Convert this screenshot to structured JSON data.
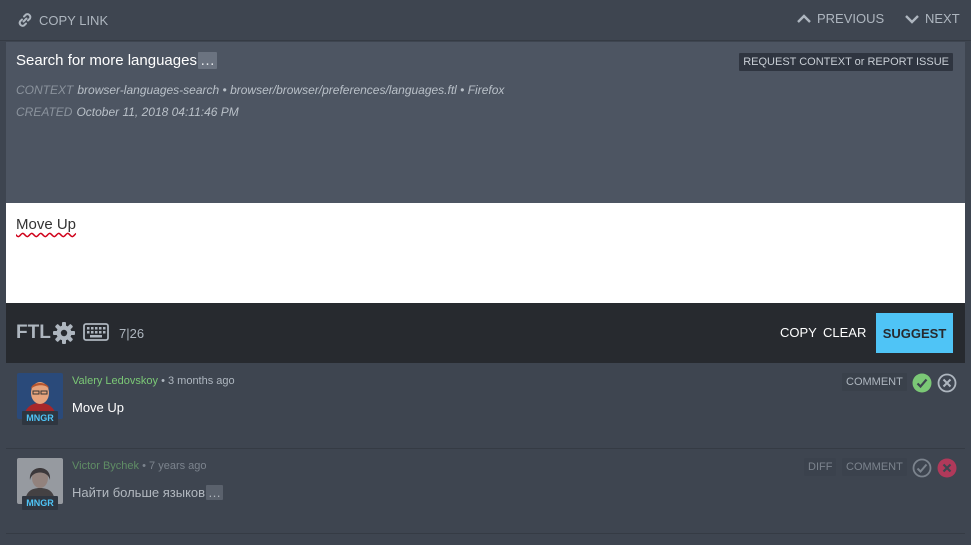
{
  "header": {
    "copy_link": "COPY LINK",
    "previous": "PREVIOUS",
    "next": "NEXT"
  },
  "entity": {
    "source_text": "Search for more languages",
    "ellipsis": "…",
    "request_button": "REQUEST CONTEXT or REPORT ISSUE",
    "context_label": "CONTEXT",
    "context_value": "browser-languages-search • browser/browser/preferences/languages.ftl • Firefox",
    "created_label": "CREATED",
    "created_value": "October 11, 2018 04:11:46 PM"
  },
  "editor": {
    "value": "Move Up"
  },
  "toolbar": {
    "ftl_label": "FTL",
    "count": "7|26",
    "copy": "COPY",
    "clear": "CLEAR",
    "suggest": "SUGGEST"
  },
  "translations": [
    {
      "author": "Valery Ledovskoy",
      "time": "• 3 months ago",
      "role": "MNGR",
      "text": "Move Up",
      "comment": "COMMENT",
      "approved": true
    },
    {
      "author": "Victor Bychek",
      "time": "• 7 years ago",
      "role": "MNGR",
      "text": "Найти больше языков",
      "ellipsis": "…",
      "diff": "DIFF",
      "comment": "COMMENT",
      "approved": false
    }
  ],
  "colors": {
    "accent": "#4fc4f6",
    "approve_green": "#7bc876",
    "reject_red": "#f36"
  }
}
